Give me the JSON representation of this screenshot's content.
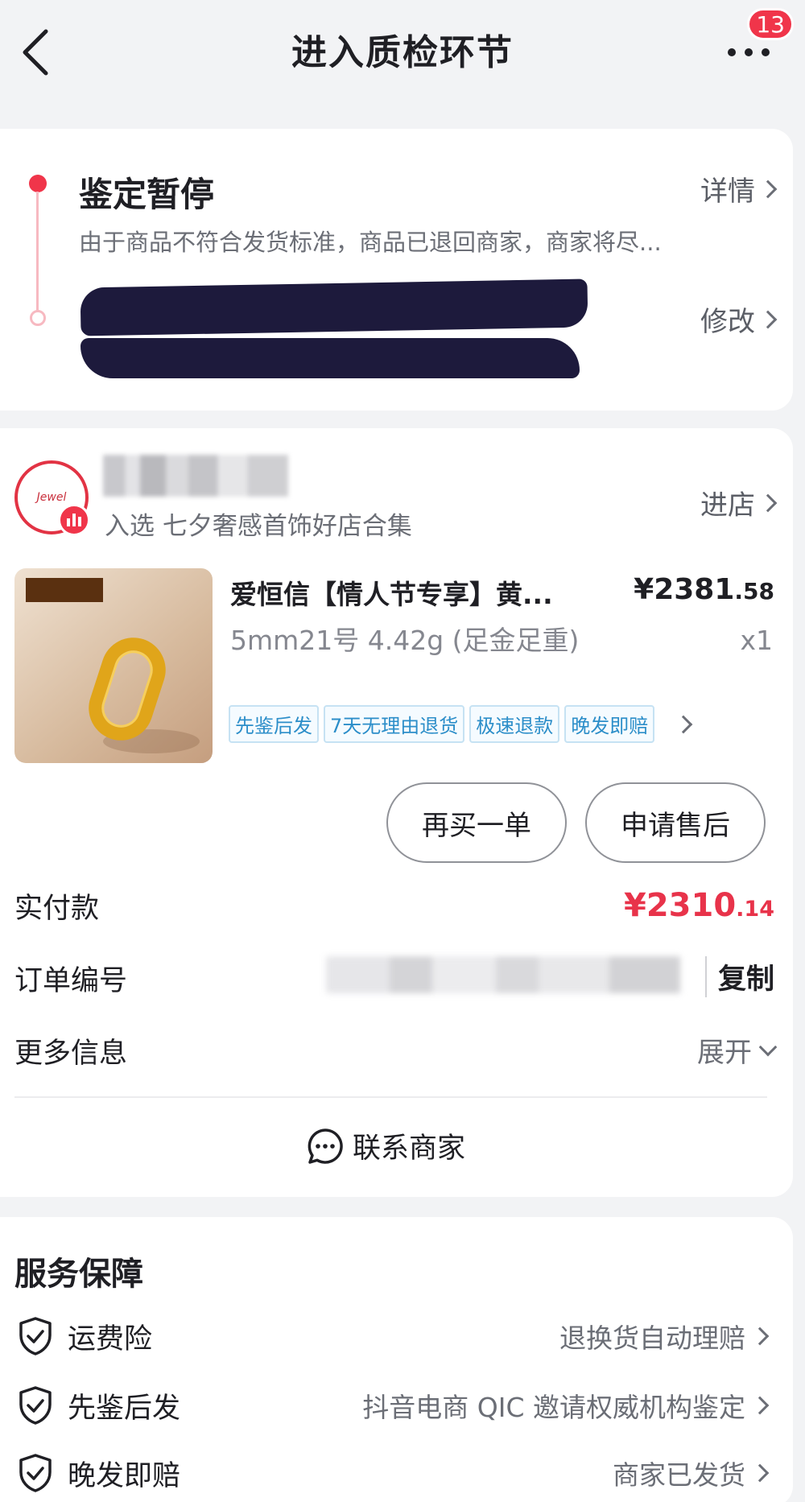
{
  "nav": {
    "title": "进入质检环节",
    "badge": "13"
  },
  "status": {
    "title": "鉴定暂停",
    "description": "由于商品不符合发货标准，商品已退回商家，商家将尽...",
    "details_link": "详情",
    "modify_link": "修改"
  },
  "shop": {
    "subtitle": "入选 七夕奢感首饰好店合集",
    "enter_link": "进店"
  },
  "product": {
    "title": "爱恒信【情人节专享】黄...",
    "price_main": "¥2381",
    "price_decimal": ".58",
    "spec": "5mm21号 4.42g (足金足重)",
    "qty": "x1",
    "tags": [
      "先鉴后发",
      "7天无理由退货",
      "极速退款",
      "晚发即赔"
    ]
  },
  "actions": {
    "rebuy": "再买一单",
    "after_sale": "申请售后"
  },
  "order": {
    "paid_label": "实付款",
    "paid_main": "¥2310",
    "paid_decimal": ".14",
    "order_no_label": "订单编号",
    "copy": "复制",
    "more_label": "更多信息",
    "expand": "展开",
    "contact": "联系商家"
  },
  "service": {
    "title": "服务保障",
    "items": [
      {
        "label": "运费险",
        "value": "退换货自动理赔"
      },
      {
        "label": "先鉴后发",
        "value": "抖音电商 QIC 邀请权威机构鉴定"
      },
      {
        "label": "晚发即赔",
        "value": "商家已发货"
      }
    ]
  },
  "colors": {
    "accent": "#f0354a",
    "tag_blue": "#2c8ec9",
    "redaction": "#1d1a3c"
  }
}
